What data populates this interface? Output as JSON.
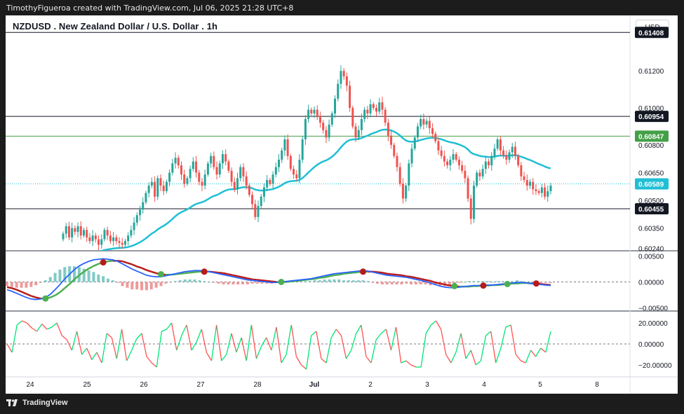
{
  "header": {
    "attribution": "TimothyFigueroa created with TradingView.com, Jul 06, 2025 21:28 UTC+8"
  },
  "chart_header": {
    "title": "NZDUSD . New Zealand Dollar / U.S. Dollar . 1h",
    "currency_button": "USD"
  },
  "footer": {
    "brand": "TradingView",
    "logo_icon": "tradingview-logo-icon"
  },
  "colors": {
    "up": "#26a69a",
    "down": "#ef5350",
    "ma": "#1fbfd4",
    "macd_line": "#2962ff",
    "signal_line": "#b71c1c",
    "cross_bull": "#4caf50",
    "cross_bear": "#b71c1c",
    "osc_up": "#00e676",
    "osc_down": "#ff5252",
    "hline_black": "#131722",
    "hline_green": "#43a047"
  },
  "chart_data": [
    {
      "type": "candlestick",
      "panel": "price",
      "x_tick_labels": [
        "24",
        "25",
        "26",
        "27",
        "28",
        "Jul",
        "2",
        "3",
        "4",
        "5",
        "8"
      ],
      "y_tick_labels": [
        "0.61200",
        "0.61000",
        "0.60800",
        "0.60650",
        "0.60500",
        "0.60350",
        "0.60240"
      ],
      "ylim": [
        0.6022,
        0.615
      ],
      "horizontal_lines": [
        {
          "value": 0.61408,
          "label": "0.61408",
          "color": "black"
        },
        {
          "value": 0.60954,
          "label": "0.60954",
          "color": "black"
        },
        {
          "value": 0.60847,
          "label": "0.60847",
          "color": "green"
        },
        {
          "value": 0.60455,
          "label": "0.60455",
          "color": "black"
        }
      ],
      "last_price": {
        "value": 0.60589,
        "label": "0.60589"
      },
      "closes": [
        0.6032,
        0.6036,
        0.603,
        0.6035,
        0.6033,
        0.6036,
        0.6031,
        0.6034,
        0.603,
        0.6028,
        0.6031,
        0.6029,
        0.6026,
        0.6029,
        0.6034,
        0.6031,
        0.6028,
        0.603,
        0.6028,
        0.6027,
        0.6026,
        0.6028,
        0.6031,
        0.6034,
        0.6038,
        0.6042,
        0.6045,
        0.6049,
        0.6054,
        0.6058,
        0.606,
        0.6052,
        0.6062,
        0.6058,
        0.6055,
        0.606,
        0.6065,
        0.607,
        0.6073,
        0.6069,
        0.6064,
        0.6059,
        0.6062,
        0.6067,
        0.6071,
        0.6065,
        0.606,
        0.6058,
        0.6064,
        0.607,
        0.6074,
        0.6068,
        0.6064,
        0.607,
        0.6075,
        0.6071,
        0.6066,
        0.606,
        0.6056,
        0.6062,
        0.6068,
        0.6063,
        0.6058,
        0.6053,
        0.6048,
        0.6041,
        0.6047,
        0.6052,
        0.6057,
        0.6061,
        0.6059,
        0.6064,
        0.6068,
        0.6072,
        0.6077,
        0.6083,
        0.6074,
        0.6067,
        0.6064,
        0.6062,
        0.6072,
        0.6083,
        0.6094,
        0.6099,
        0.6097,
        0.6099,
        0.6095,
        0.6092,
        0.6088,
        0.6084,
        0.6091,
        0.6097,
        0.6105,
        0.6113,
        0.612,
        0.6117,
        0.6112,
        0.61,
        0.609,
        0.6084,
        0.6088,
        0.6094,
        0.6099,
        0.6097,
        0.6102,
        0.61,
        0.6098,
        0.6103,
        0.6099,
        0.6092,
        0.6085,
        0.608,
        0.6074,
        0.6068,
        0.6059,
        0.6051,
        0.6058,
        0.607,
        0.6078,
        0.6084,
        0.609,
        0.6094,
        0.6091,
        0.6093,
        0.6089,
        0.6086,
        0.6082,
        0.6077,
        0.6074,
        0.6071,
        0.6069,
        0.6072,
        0.6075,
        0.6072,
        0.6069,
        0.6066,
        0.6062,
        0.6051,
        0.604,
        0.6058,
        0.6065,
        0.6063,
        0.6067,
        0.6071,
        0.6069,
        0.6074,
        0.6078,
        0.6083,
        0.6077,
        0.6074,
        0.6072,
        0.6076,
        0.6079,
        0.6074,
        0.6069,
        0.6063,
        0.6061,
        0.6058,
        0.606,
        0.6056,
        0.6055,
        0.6054,
        0.6057,
        0.6052,
        0.6055,
        0.6058
      ],
      "ma_series": [
        {
          "x": 40,
          "y": 0.6017
        },
        {
          "x": 60,
          "y": 0.6024
        },
        {
          "x": 80,
          "y": 0.603
        },
        {
          "x": 100,
          "y": 0.6037
        },
        {
          "x": 120,
          "y": 0.6046
        },
        {
          "x": 140,
          "y": 0.6056
        },
        {
          "x": 150,
          "y": 0.6058
        },
        {
          "x": 166,
          "y": 0.6059
        }
      ]
    },
    {
      "type": "line",
      "panel": "macd",
      "y_tick_labels": [
        "0.00500",
        "0.00000",
        "−0.00500"
      ],
      "ylim": [
        -0.0055,
        0.0055
      ],
      "macd": [
        -0.0015,
        -0.0018,
        -0.0022,
        -0.0026,
        -0.003,
        -0.0033,
        -0.0034,
        -0.0033,
        -0.003,
        -0.0024,
        -0.0015,
        -0.0005,
        0.0006,
        0.0015,
        0.0024,
        0.0031,
        0.0036,
        0.004,
        0.0043,
        0.0044,
        0.0045,
        0.0044,
        0.0043,
        0.004,
        0.0035,
        0.003,
        0.0025,
        0.0021,
        0.0017,
        0.0013,
        0.0011,
        0.001,
        0.001,
        0.0012,
        0.0014,
        0.0016,
        0.0018,
        0.002,
        0.0021,
        0.0022,
        0.0022,
        0.0021,
        0.002,
        0.0018,
        0.0016,
        0.0014,
        0.0012,
        0.001,
        0.0008,
        0.0006,
        0.0004,
        0.0003,
        0.0002,
        0.0001,
        0.0,
        -0.0001,
        -0.0001,
        0.0,
        0.0001,
        0.0002,
        0.0003,
        0.0004,
        0.0005,
        0.0006,
        0.0008,
        0.001,
        0.0012,
        0.0014,
        0.0016,
        0.0017,
        0.0018,
        0.0019,
        0.002,
        0.0021,
        0.0022,
        0.0021,
        0.0019,
        0.0017,
        0.0015,
        0.0013,
        0.0012,
        0.0011,
        0.001,
        0.0009,
        0.0007,
        0.0005,
        0.0003,
        0.0001,
        -0.0002,
        -0.0005,
        -0.0008,
        -0.001,
        -0.0011,
        -0.0011,
        -0.001,
        -0.0009,
        -0.0008,
        -0.0007,
        -0.0007,
        -0.0006,
        -0.0006,
        -0.0006,
        -0.0005,
        -0.0004,
        -0.0003,
        -0.0002,
        -0.0001,
        -0.0001,
        -0.0002,
        -0.0003,
        -0.0004,
        -0.0005,
        -0.0006,
        -0.0007
      ],
      "signal": [
        -0.001,
        -0.0012,
        -0.0015,
        -0.0019,
        -0.0023,
        -0.0027,
        -0.003,
        -0.0032,
        -0.0032,
        -0.003,
        -0.0026,
        -0.002,
        -0.0012,
        -0.0004,
        0.0005,
        0.0013,
        0.002,
        0.0026,
        0.0031,
        0.0035,
        0.0038,
        0.004,
        0.0041,
        0.0041,
        0.004,
        0.0037,
        0.0034,
        0.003,
        0.0027,
        0.0023,
        0.002,
        0.0017,
        0.0015,
        0.0014,
        0.0014,
        0.0015,
        0.0016,
        0.0017,
        0.0018,
        0.0019,
        0.002,
        0.002,
        0.002,
        0.0019,
        0.0018,
        0.0017,
        0.0015,
        0.0013,
        0.0011,
        0.0009,
        0.0007,
        0.0005,
        0.0004,
        0.0003,
        0.0002,
        0.0001,
        0.0,
        0.0,
        0.0,
        0.0001,
        0.0002,
        0.0003,
        0.0004,
        0.0005,
        0.0006,
        0.0008,
        0.0009,
        0.0011,
        0.0013,
        0.0014,
        0.0016,
        0.0017,
        0.0018,
        0.0019,
        0.002,
        0.002,
        0.002,
        0.0019,
        0.0018,
        0.0016,
        0.0015,
        0.0014,
        0.0013,
        0.0011,
        0.001,
        0.0008,
        0.0006,
        0.0004,
        0.0002,
        -0.0001,
        -0.0003,
        -0.0005,
        -0.0007,
        -0.0008,
        -0.0009,
        -0.0009,
        -0.0009,
        -0.0008,
        -0.0008,
        -0.0007,
        -0.0007,
        -0.0006,
        -0.0006,
        -0.0005,
        -0.0004,
        -0.0003,
        -0.0003,
        -0.0002,
        -0.0002,
        -0.0003,
        -0.0003,
        -0.0004,
        -0.0005,
        -0.0006
      ],
      "crosses": [
        {
          "i": 8,
          "kind": "bull"
        },
        {
          "i": 20,
          "kind": "bear"
        },
        {
          "i": 32,
          "kind": "bull"
        },
        {
          "i": 41,
          "kind": "bear"
        },
        {
          "i": 57,
          "kind": "bull"
        },
        {
          "i": 74,
          "kind": "bear"
        },
        {
          "i": 93,
          "kind": "bull"
        },
        {
          "i": 99,
          "kind": "bear"
        },
        {
          "i": 104,
          "kind": "bull"
        },
        {
          "i": 110,
          "kind": "bear"
        }
      ]
    },
    {
      "type": "line",
      "panel": "oscillator",
      "y_tick_labels": [
        "20.00000",
        "0.00000",
        "−20.00000"
      ],
      "ylim": [
        -30,
        30
      ],
      "values": [
        0,
        -8,
        18,
        22,
        20,
        15,
        12,
        19,
        14,
        16,
        20,
        8,
        4,
        -6,
        12,
        -10,
        -4,
        -15,
        -8,
        -18,
        10,
        6,
        -14,
        14,
        -16,
        -6,
        5,
        10,
        -12,
        -18,
        -22,
        12,
        14,
        20,
        -6,
        8,
        18,
        -6,
        2,
        14,
        -8,
        -16,
        18,
        -16,
        -10,
        10,
        -8,
        6,
        -16,
        18,
        -14,
        -2,
        6,
        -6,
        16,
        -18,
        -10,
        18,
        -12,
        -20,
        -24,
        8,
        12,
        -14,
        -18,
        6,
        14,
        8,
        -14,
        -6,
        10,
        18,
        -12,
        -18,
        4,
        10,
        14,
        -6,
        16,
        -18,
        -16,
        -20,
        -22,
        -22,
        10,
        18,
        22,
        14,
        -10,
        -18,
        -8,
        10,
        -14,
        -6,
        -20,
        -16,
        8,
        12,
        -18,
        -4,
        16,
        18,
        -10,
        -16,
        -18,
        -6,
        -12,
        -4,
        -8,
        12
      ],
      "dashed_zero": true
    }
  ]
}
